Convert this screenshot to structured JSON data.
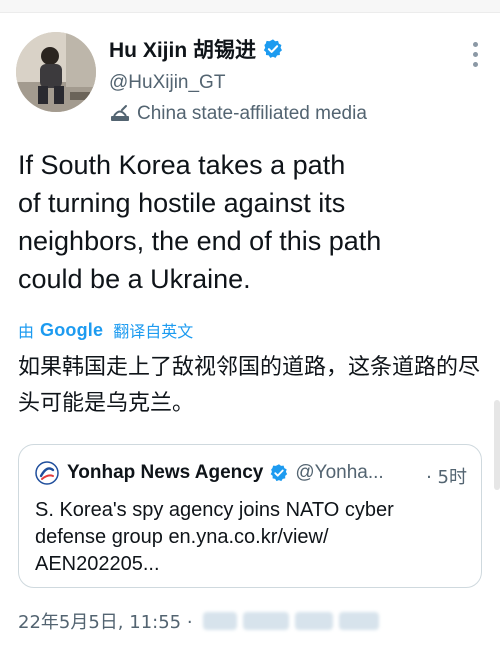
{
  "author": {
    "display_name": "Hu Xijin 胡锡进",
    "handle": "@HuXijin_GT",
    "affiliation": "China state-affiliated media",
    "verified": true
  },
  "tweet": {
    "text": "If South Korea takes a path\nof turning hostile against its\nneighbors, the end of this path\ncould be a Ukraine.",
    "translate_by": "由",
    "translate_brand": "Google",
    "translate_label": "翻译自英文",
    "translated_text": "如果韩国走上了敌视邻国的道路，这条道路的尽头可能是乌克兰。"
  },
  "quoted_tweet": {
    "author_name": "Yonhap News Agency",
    "author_handle": "@Yonha...",
    "time": "· 5时",
    "text": "S. Korea's spy agency joins NATO cyber\ndefense group en.yna.co.kr/view/\nAEN202205..."
  },
  "timestamp": "22年5月5日, 11:55 ·",
  "colors": {
    "accent": "#1d9bf0",
    "secondary_text": "#536471",
    "primary_text": "#0f1419",
    "border": "#cfd9de"
  },
  "icons": {
    "more": "more-options-icon",
    "verified": "verified-badge-icon",
    "affiliation": "state-media-icon",
    "quote_logo": "yonhap-logo-icon"
  }
}
